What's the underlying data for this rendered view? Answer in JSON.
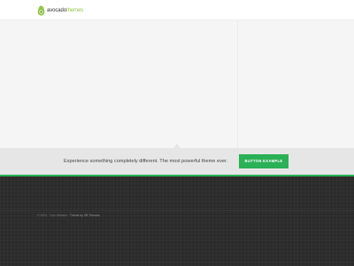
{
  "header": {
    "logo": {
      "text_main": "avocado",
      "text_accent": "themes",
      "colors": {
        "accent": "#8dc63f",
        "text": "#333333"
      }
    }
  },
  "hero": {
    "background": "#f5f5f5"
  },
  "cta": {
    "text": "Experience something completely different. The most powerful theme ever.",
    "button_label": "Button Example",
    "button_color": "#2ab056"
  },
  "footer": {
    "copyright": "© 2024 · Your Website",
    "separator": " · ",
    "theme_credit": "Theme by VB Themes"
  }
}
